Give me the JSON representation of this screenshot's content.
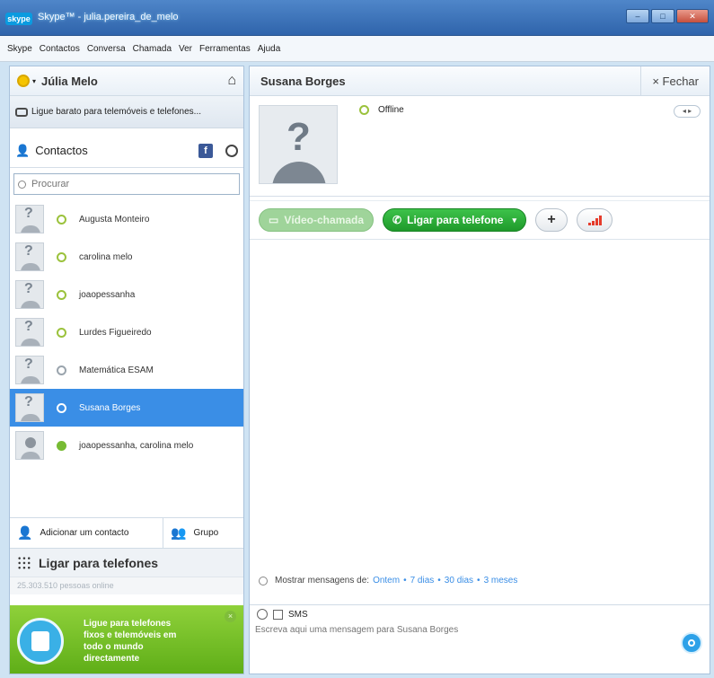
{
  "window": {
    "title": "Skype™ - julia.pereira_de_melo",
    "logo": "skype"
  },
  "menu": [
    "Skype",
    "Contactos",
    "Conversa",
    "Chamada",
    "Ver",
    "Ferramentas",
    "Ajuda"
  ],
  "profile": {
    "name": "Júlia Melo"
  },
  "promo_bar": {
    "text": "Ligue barato para telemóveis e telefones..."
  },
  "contacts_tab": {
    "label": "Contactos",
    "facebook_icon": "f"
  },
  "search": {
    "placeholder": "Procurar"
  },
  "contacts": [
    {
      "name": "Augusta Monteiro",
      "status": "online"
    },
    {
      "name": "carolina melo",
      "status": "online"
    },
    {
      "name": "joaopessanha",
      "status": "online"
    },
    {
      "name": "Lurdes Figueiredo",
      "status": "online"
    },
    {
      "name": "Matemática ESAM",
      "status": "clock"
    },
    {
      "name": "Susana Borges",
      "status": "offline",
      "selected": true
    },
    {
      "name": "joaopessanha, carolina melo",
      "status": "group"
    }
  ],
  "actions": {
    "add_contact": "Adicionar um contacto",
    "group": "Grupo"
  },
  "call_phones": {
    "label": "Ligar para telefones"
  },
  "online_count": "25.303.510 pessoas online",
  "ad": {
    "text": "Ligue para telefones fixos e telemóveis em todo o mundo directamente"
  },
  "conversation": {
    "name": "Susana Borges",
    "close": "× Fechar",
    "status": "Offline",
    "buttons": {
      "video": "Vídeo-chamada",
      "phone": "Ligar para telefone"
    },
    "history": {
      "label": "Mostrar mensagens de:",
      "links": [
        "Ontem",
        "7 dias",
        "30 dias",
        "3 meses"
      ]
    },
    "compose": {
      "sms": "SMS",
      "placeholder": "Escreva aqui uma mensagem para Susana Borges"
    }
  }
}
